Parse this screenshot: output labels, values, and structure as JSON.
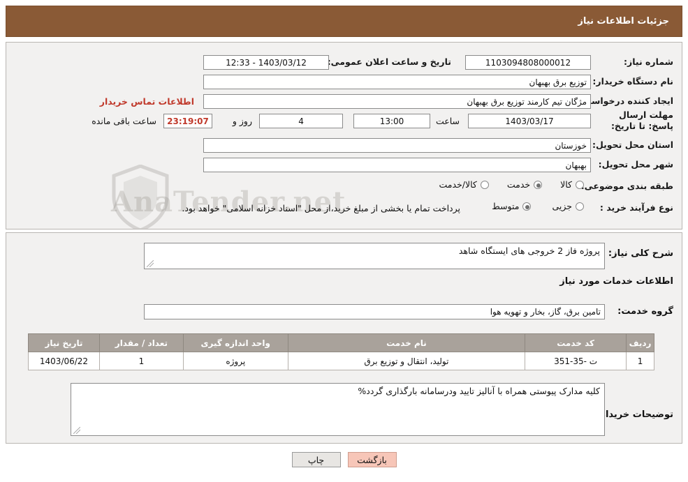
{
  "header": {
    "title": "جزئیات اطلاعات نیاز"
  },
  "watermark": {
    "text": "AnaTender.net",
    "icon": "shield-icon"
  },
  "form": {
    "need_number": {
      "label": "شماره نیاز:",
      "value": "1103094808000012"
    },
    "announce_datetime": {
      "label": "تاریخ و ساعت اعلان عمومی:",
      "value": "1403/03/12 - 12:33"
    },
    "buyer_org": {
      "label": "نام دستگاه خریدار:",
      "value": "توزیع برق بهبهان"
    },
    "requester": {
      "label": "ایجاد کننده درخواست:",
      "value": "مژگان تیم کارمند توزیع برق بهبهان"
    },
    "buyer_contact_link": {
      "label": "اطلاعات تماس خریدار"
    },
    "deadline": {
      "label": "مهلت ارسال پاسخ: تا تاریخ:",
      "date": "1403/03/17",
      "time_label": "ساعت",
      "time": "13:00",
      "days": "4",
      "days_label": "روز و",
      "countdown": "23:19:07",
      "remaining_label": "ساعت باقی مانده"
    },
    "delivery_province": {
      "label": "استان محل تحویل:",
      "value": "خوزستان"
    },
    "delivery_city": {
      "label": "شهر محل تحویل:",
      "value": "بهبهان"
    },
    "category": {
      "label": "طبقه بندی موضوعی:",
      "options": [
        {
          "label": "کالا",
          "selected": false
        },
        {
          "label": "خدمت",
          "selected": true
        },
        {
          "label": "کالا/خدمت",
          "selected": false
        }
      ]
    },
    "purchase_process": {
      "label": "نوع فرآیند خرید :",
      "options": [
        {
          "label": "جزیی",
          "selected": false
        },
        {
          "label": "متوسط",
          "selected": true
        }
      ],
      "note": "پرداخت تمام یا بخشی از مبلغ خرید،از محل \"اسناد خزانه اسلامی\" خواهد بود."
    },
    "general_description": {
      "label": "شرح کلی نیاز:",
      "value": "پروژه فاز 2 خروجی های ایستگاه شاهد"
    },
    "services_section_title": "اطلاعات خدمات مورد نیاز",
    "service_group": {
      "label": "گروه خدمت:",
      "value": "تامین برق، گاز، بخار و تهویه هوا"
    },
    "buyer_notes": {
      "label": "توضیحات خریدار:",
      "value": "کلیه مدارک پیوستی همراه با آنالیز تایید ودرسامانه بارگذاری گردد%"
    }
  },
  "table": {
    "columns": [
      "ردیف",
      "کد خدمت",
      "نام خدمت",
      "واحد اندازه گیری",
      "تعداد / مقدار",
      "تاریخ نیاز"
    ],
    "rows": [
      {
        "row_no": "1",
        "service_code": "ت -35-351",
        "service_name": "تولید، انتقال و توزیع برق",
        "unit": "پروژه",
        "quantity": "1",
        "need_date": "1403/06/22"
      }
    ]
  },
  "buttons": {
    "print": "چاپ",
    "back": "بازگشت"
  }
}
